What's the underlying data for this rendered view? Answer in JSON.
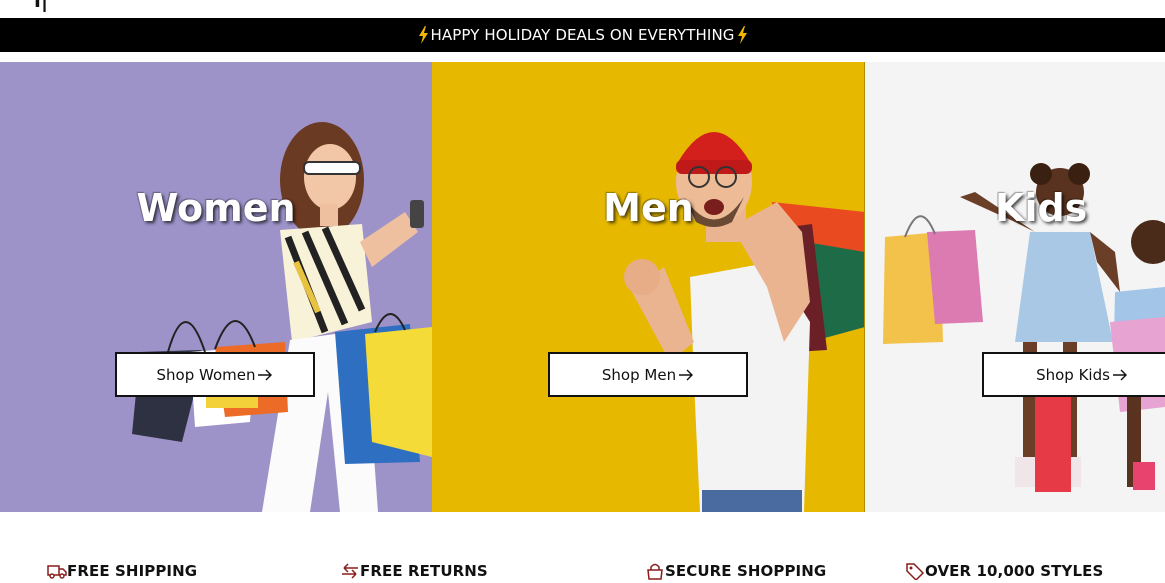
{
  "header": {
    "logo_fragment": "ı|"
  },
  "announcement": {
    "text": "HAPPY HOLIDAY DEALS ON EVERYTHING",
    "icon": "lightning-bolt-icon",
    "icon_color": "#f2b705"
  },
  "panels": [
    {
      "title": "Women",
      "button_label": "Shop Women",
      "background": "#9d93c9"
    },
    {
      "title": "Men",
      "button_label": "Shop Men",
      "background": "#e6b800"
    },
    {
      "title": "Kids",
      "button_label": "Shop Kids",
      "background": "#f4f4f4"
    }
  ],
  "features": [
    {
      "label": "FREE SHIPPING",
      "icon": "delivery-truck-icon"
    },
    {
      "label": "FREE RETURNS",
      "icon": "return-arrows-icon"
    },
    {
      "label": "SECURE SHOPPING",
      "icon": "shopping-bag-lock-icon"
    },
    {
      "label": "OVER 10,000 STYLES",
      "icon": "price-tag-icon"
    }
  ]
}
